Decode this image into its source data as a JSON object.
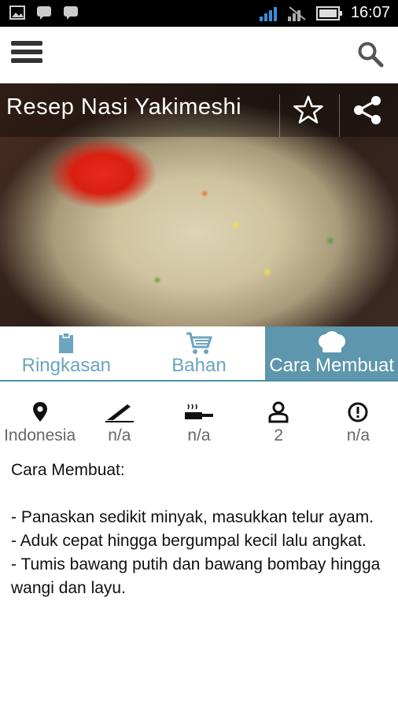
{
  "status_bar": {
    "time": "16:07"
  },
  "recipe": {
    "title": "Resep  Nasi Yakimeshi"
  },
  "tabs": [
    {
      "label": "Ringkasan",
      "icon": "clipboard-icon"
    },
    {
      "label": "Bahan",
      "icon": "shopping-cart-icon"
    },
    {
      "label": "Cara Membuat",
      "icon": "chef-hat-icon",
      "active": true
    }
  ],
  "info": {
    "origin": "Indonesia",
    "prep_time": "n/a",
    "cook_time": "n/a",
    "servings": "2",
    "difficulty": "n/a"
  },
  "content": {
    "heading": "Cara Membuat:",
    "steps": [
      "- Panaskan sedikit minyak, masukkan telur ayam.",
      "- Aduk cepat hingga bergumpal kecil lalu angkat.",
      "- Tumis bawang putih dan bawang bombay hingga wangi dan layu."
    ]
  },
  "colors": {
    "accent": "#5d96ad",
    "tab_text": "#6ba5be"
  }
}
